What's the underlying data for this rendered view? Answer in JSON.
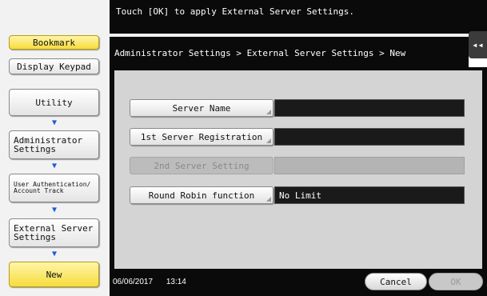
{
  "message": "Touch [OK] to apply External Server Settings.",
  "breadcrumb": "Administrator Settings > External Server Settings > New",
  "collapse_icon": "◂◂",
  "left_nav": {
    "bookmark": "Bookmark",
    "display_keypad": "Display Keypad",
    "utility": "Utility",
    "administrator_settings": "Administrator Settings",
    "user_auth": "User Authentication/ Account Track",
    "external_server": "External Server Settings",
    "new": "New",
    "arrow_icon": "down-arrow"
  },
  "form": {
    "server_name": {
      "label": "Server Name",
      "value": ""
    },
    "first_server": {
      "label": "1st Server Registration",
      "value": ""
    },
    "second_server": {
      "label": "2nd Server Setting",
      "value": ""
    },
    "round_robin": {
      "label": "Round Robin function",
      "value": "No Limit"
    }
  },
  "footer": {
    "datetime": "06/06/2017 13:14",
    "cancel": "Cancel",
    "ok": "OK"
  }
}
